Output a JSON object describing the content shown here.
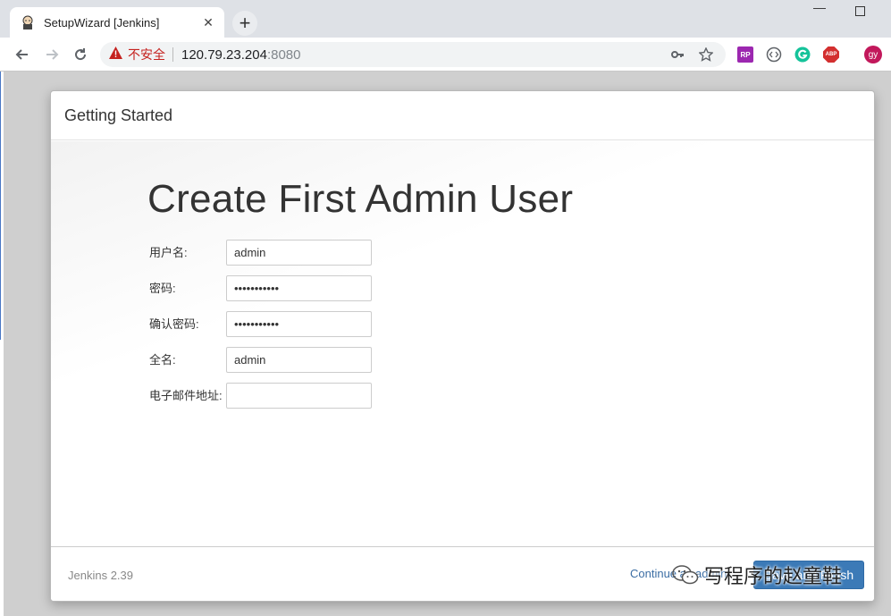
{
  "browser": {
    "tab_title": "SetupWizard [Jenkins]",
    "security_label": "不安全",
    "url_host": "120.79.23.204",
    "url_port": ":8080",
    "profile_initials": "gy",
    "ext_rp_label": "RP",
    "ext_abp_label": "ABP"
  },
  "dialog": {
    "header_title": "Getting Started",
    "heading": "Create First Admin User",
    "fields": [
      {
        "label": "用户名:",
        "value": "admin",
        "type": "text"
      },
      {
        "label": "密码:",
        "value": "•••••••••••",
        "type": "password"
      },
      {
        "label": "确认密码:",
        "value": "•••••••••••",
        "type": "password"
      },
      {
        "label": "全名:",
        "value": "admin",
        "type": "text"
      },
      {
        "label": "电子邮件地址:",
        "value": "",
        "type": "text"
      }
    ],
    "footer": {
      "version": "Jenkins 2.39",
      "continue_label": "Continue as admin",
      "save_label": "Save and Finish"
    }
  },
  "watermark": {
    "text": "写程序的赵童鞋"
  },
  "colors": {
    "accent": "#3c7ab7",
    "warning": "#c5221f"
  }
}
